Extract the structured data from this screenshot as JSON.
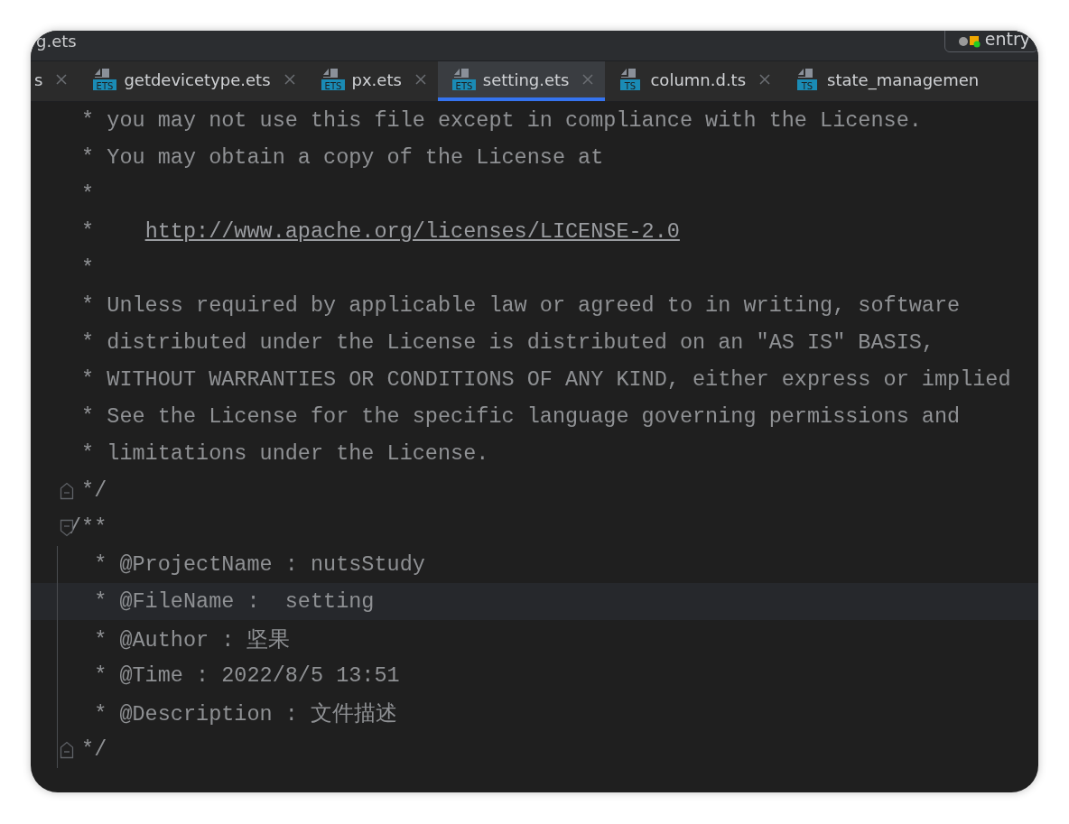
{
  "window": {
    "title": "g.ets",
    "run_config": "entry"
  },
  "tabs": [
    {
      "label": "s",
      "selected": false
    },
    {
      "label": "getdevicetype.ets",
      "type": "ETS",
      "selected": false
    },
    {
      "label": "px.ets",
      "type": "ETS",
      "selected": false
    },
    {
      "label": "setting.ets",
      "type": "ETS",
      "selected": true
    },
    {
      "label": "column.d.ts",
      "type": "TS",
      "selected": false
    },
    {
      "label": "state_managemen",
      "type": "TS",
      "selected": false,
      "closable": false
    }
  ],
  "lines": [
    {
      "kind": "plain",
      "text": " * you may not use this file except in compliance with the License.",
      "current": false
    },
    {
      "kind": "plain",
      "text": " * You may obtain a copy of the License at",
      "current": false
    },
    {
      "kind": "plain",
      "text": " *",
      "current": false
    },
    {
      "kind": "link",
      "text": " *    ",
      "url": "http://www.apache.org/licenses/LICENSE-2.0",
      "current": false
    },
    {
      "kind": "plain",
      "text": " *",
      "current": false
    },
    {
      "kind": "plain",
      "text": " * Unless required by applicable law or agreed to in writing, software",
      "current": false
    },
    {
      "kind": "plain",
      "text": " * distributed under the License is distributed on an \"AS IS\" BASIS,",
      "current": false
    },
    {
      "kind": "plain",
      "text": " * WITHOUT WARRANTIES OR CONDITIONS OF ANY KIND, either express or implied",
      "current": false
    },
    {
      "kind": "plain",
      "text": " * See the License for the specific language governing permissions and",
      "current": false
    },
    {
      "kind": "plain",
      "text": " * limitations under the License.",
      "current": false
    },
    {
      "kind": "fold-end",
      "text": " */",
      "current": false
    },
    {
      "kind": "fold-start",
      "text": "/**",
      "current": false
    },
    {
      "kind": "plain",
      "text": "  * @ProjectName : nutsStudy",
      "current": false
    },
    {
      "kind": "plain",
      "text": "  * @FileName :  setting",
      "current": true
    },
    {
      "kind": "plain",
      "text": "  * @Author : 坚果",
      "current": false
    },
    {
      "kind": "plain",
      "text": "  * @Time : 2022/8/5 13:51",
      "current": false
    },
    {
      "kind": "plain",
      "text": "  * @Description : 文件描述",
      "current": false
    },
    {
      "kind": "fold-end",
      "text": " */",
      "current": false
    }
  ]
}
